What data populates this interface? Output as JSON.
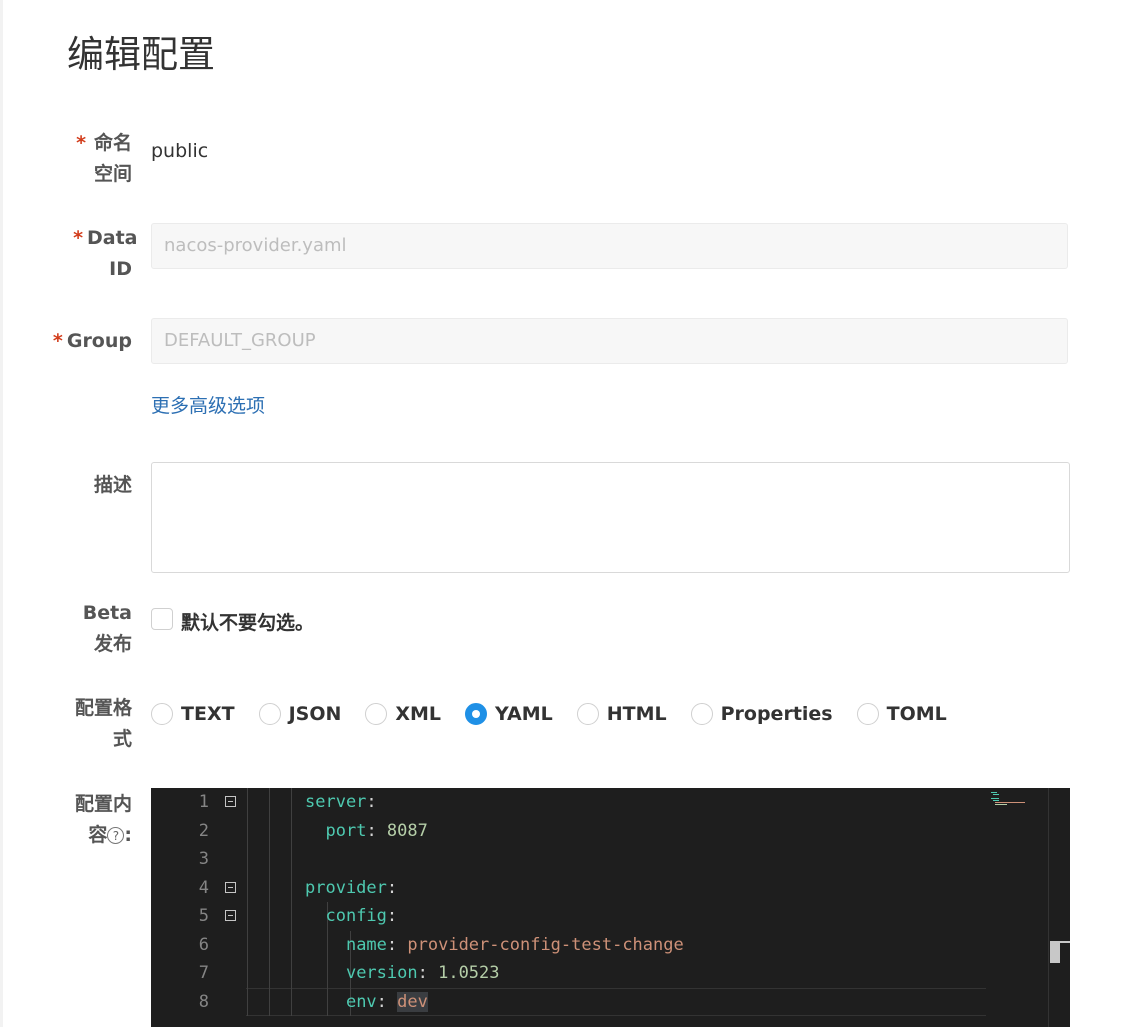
{
  "page": {
    "title": "编辑配置"
  },
  "form": {
    "namespace": {
      "label_star": "*",
      "label": "命名空间",
      "value": "public"
    },
    "data_id": {
      "label_star": "*",
      "label": "Data ID",
      "value": "nacos-provider.yaml"
    },
    "group": {
      "label_star": "*",
      "label": "Group",
      "value": "DEFAULT_GROUP"
    },
    "advanced_link": "更多高级选项",
    "description": {
      "label": "描述",
      "value": ""
    },
    "beta": {
      "label": "Beta发布",
      "checkbox_label": "默认不要勾选。",
      "checked": false
    },
    "format": {
      "label": "配置格式",
      "selected": "YAML",
      "options": [
        "TEXT",
        "JSON",
        "XML",
        "YAML",
        "HTML",
        "Properties",
        "TOML"
      ]
    },
    "content": {
      "label": "配置内容",
      "help_icon": "question-circle-icon",
      "help_glyph": "?",
      "colon": ":"
    }
  },
  "editor": {
    "line_numbers": [
      "1",
      "2",
      "3",
      "4",
      "5",
      "6",
      "7",
      "8"
    ],
    "lines": [
      "server:",
      "  port: 8087",
      "",
      "provider:",
      "  config:",
      "    name: provider-config-test-change",
      "    version: 1.0523",
      "    env: dev"
    ]
  },
  "colors": {
    "accent": "#1f90e6",
    "required": "#d23c1b",
    "link": "#2c6fb3",
    "editor_bg": "#1e1e1e",
    "yaml_key": "#4ec9b0",
    "yaml_string": "#ce9178",
    "yaml_number": "#b5cea8"
  }
}
